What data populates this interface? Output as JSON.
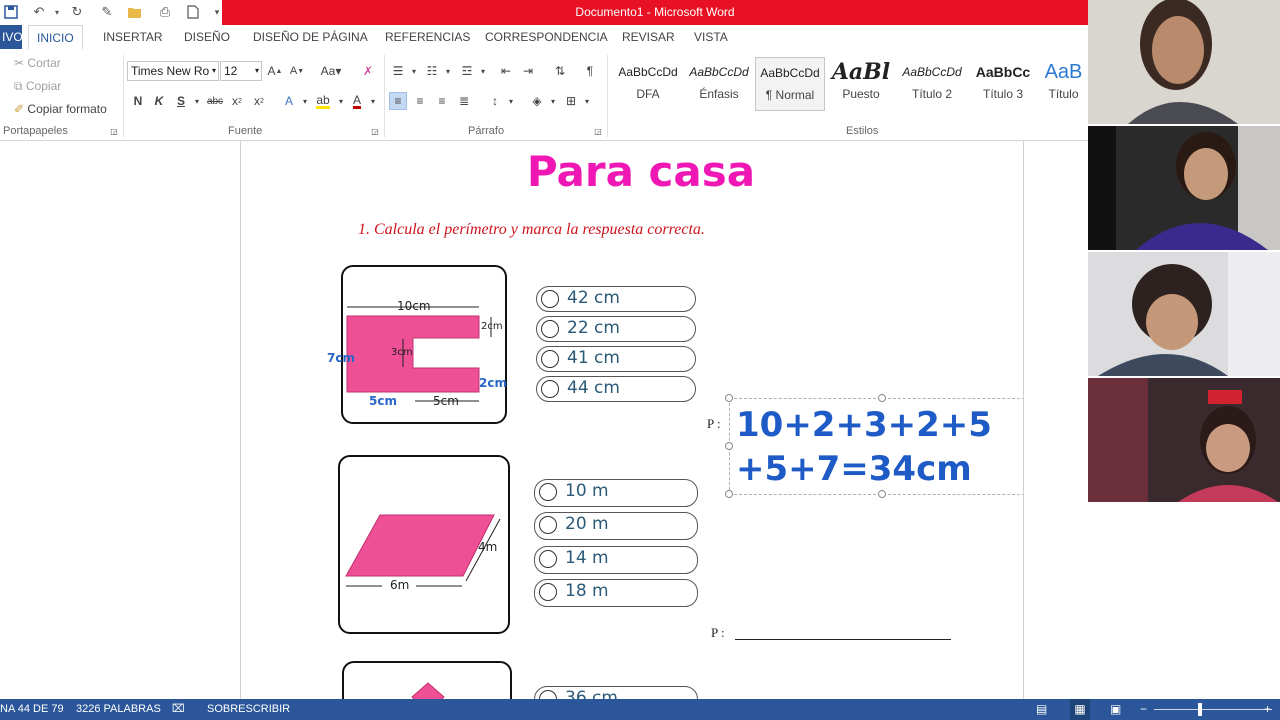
{
  "window": {
    "title": "Documento1 - Microsoft Word"
  },
  "tabs": [
    {
      "label": "IVO"
    },
    {
      "label": "INICIO"
    },
    {
      "label": "INSERTAR"
    },
    {
      "label": "DISEÑO"
    },
    {
      "label": "DISEÑO DE PÁGINA"
    },
    {
      "label": "REFERENCIAS"
    },
    {
      "label": "CORRESPONDENCIA"
    },
    {
      "label": "REVISAR"
    },
    {
      "label": "VISTA"
    }
  ],
  "clipboard": {
    "cut": "Cortar",
    "copy": "Copiar",
    "format_painter": "Copiar formato",
    "group": "Portapapeles"
  },
  "font": {
    "name": "Times New Ro",
    "size": "12",
    "group": "Fuente"
  },
  "paragraph": {
    "group": "Párrafo"
  },
  "styles": {
    "group": "Estilos",
    "items": [
      {
        "sample": "AaBbCcDd",
        "name": "DFA"
      },
      {
        "sample": "AaBbCcDd",
        "name": "Énfasis"
      },
      {
        "sample": "AaBbCcDd",
        "name": "¶ Normal"
      },
      {
        "sample": "AaBl",
        "name": "Puesto"
      },
      {
        "sample": "AaBbCcDd",
        "name": "Título 2"
      },
      {
        "sample": "AaBbCc",
        "name": "Título 3"
      },
      {
        "sample": "AaB",
        "name": "Título"
      }
    ]
  },
  "document": {
    "title": "Para casa",
    "question": "1.  Calcula el perímetro y marca  la respuesta correcta.",
    "figure1": {
      "labels": {
        "top": "10cm",
        "right_top": "2cm",
        "inner": "3cm",
        "left": "7cm",
        "right_bottom": "2cm",
        "bottom_left": "5cm",
        "bottom_right": "5cm"
      },
      "options": [
        "42 cm",
        "22 cm",
        "41 cm",
        "44 cm"
      ]
    },
    "figure2": {
      "labels": {
        "side": "4m",
        "base": "6m"
      },
      "options": [
        "10 m",
        "20 m",
        "14 m",
        "18 m"
      ]
    },
    "figure3": {
      "options": [
        "36 cm"
      ]
    },
    "answer": {
      "prefix": "P :",
      "line1": "10+2+3+2+5",
      "line2": "+5+7=34cm"
    },
    "answer2": {
      "prefix": "P :"
    }
  },
  "status": {
    "page": "NA 44 DE 79",
    "words": "3226 PALABRAS",
    "mode": "SOBRESCRIBIR"
  },
  "colors": {
    "accent": "#2b579a",
    "title_bar": "#e81123",
    "heading": "#f018b4",
    "shape_fill": "#ee4f95",
    "answer": "#1f5bc6"
  }
}
